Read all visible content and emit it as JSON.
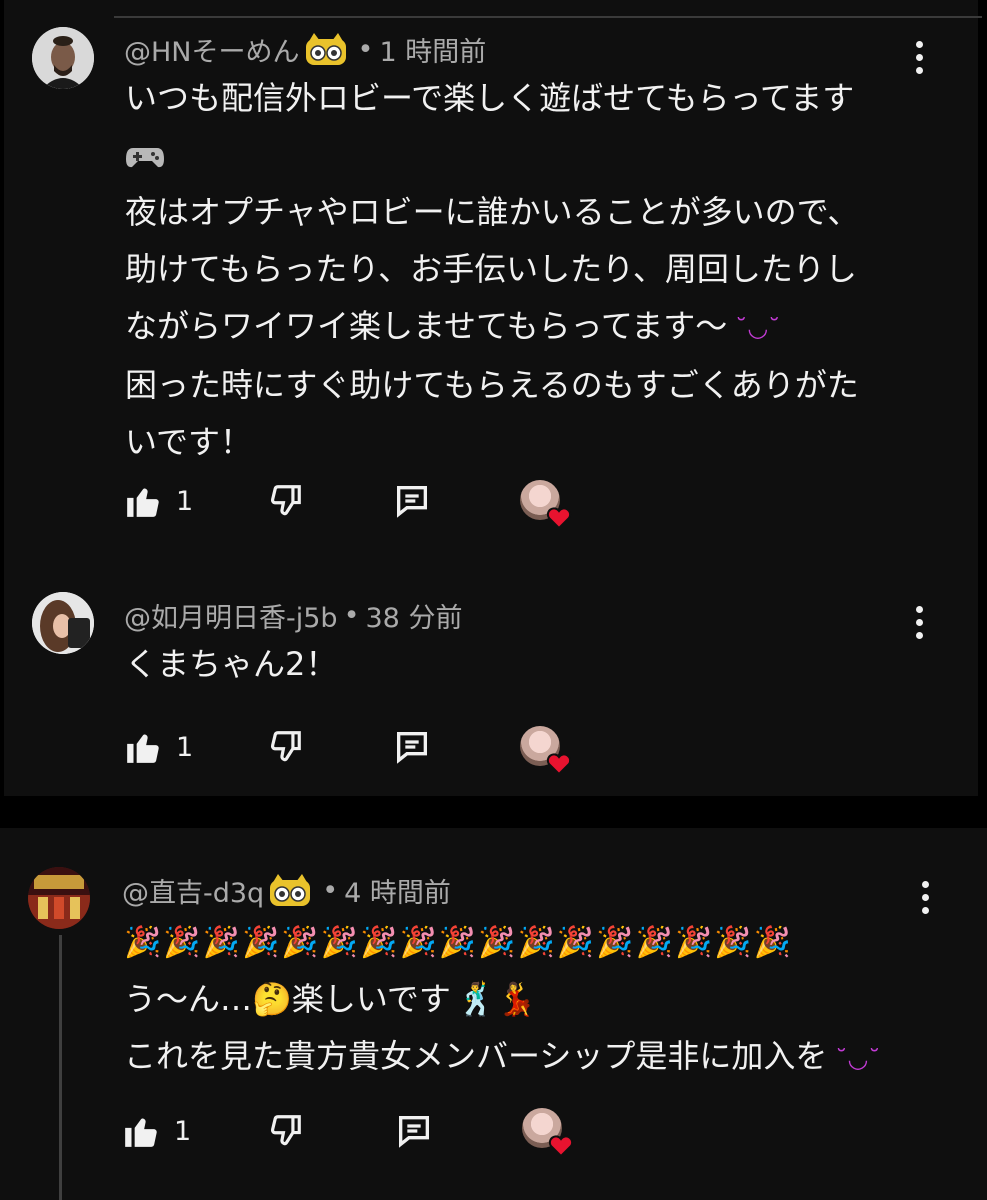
{
  "comments": [
    {
      "author": "@HNそーめん",
      "time": "1 時間前",
      "separator": "•",
      "lines": [
        "いつも配信外ロビーで楽しく遊ばせてもらってます",
        "夜はオプチャやロビーに誰かいることが多いので、",
        "助けてもらったり、お手伝いしたり、周回したりし",
        "ながらワイワイ楽しませてもらってます〜",
        "困った時にすぐ助けてもらえるのもすごくありがた",
        "いです！"
      ],
      "emoji": {
        "game": "🎮",
        "smile": "˘◡˘"
      },
      "likes": "1"
    },
    {
      "author": "@如月明日香-j5b",
      "time": "38 分前",
      "separator": "•",
      "lines": [
        "くまちゃん2！"
      ],
      "likes": "1"
    },
    {
      "author": "@直吉-d3q",
      "time": "4 時間前",
      "separator": "•",
      "party_emoji": "🎉🎉🎉🎉🎉🎉🎉🎉🎉🎉🎉🎉🎉🎉🎉🎉🎉",
      "line2_prefix": "う〜ん…",
      "line2_thinking": "🤔",
      "line2_text": "楽しいです",
      "line2_dancers": "🕺💃",
      "line3": "これを見た貴方貴女メンバーシップ是非に加入を",
      "line3_smile": "˘◡˘",
      "likes": "1"
    }
  ],
  "truncated_next_line": "",
  "colors": {
    "background": "#0f0f0f",
    "text": "#f1f1f1",
    "secondary": "#aaaaaa",
    "heart": "#e8132f",
    "emoji_purple": "#c23bd4"
  }
}
